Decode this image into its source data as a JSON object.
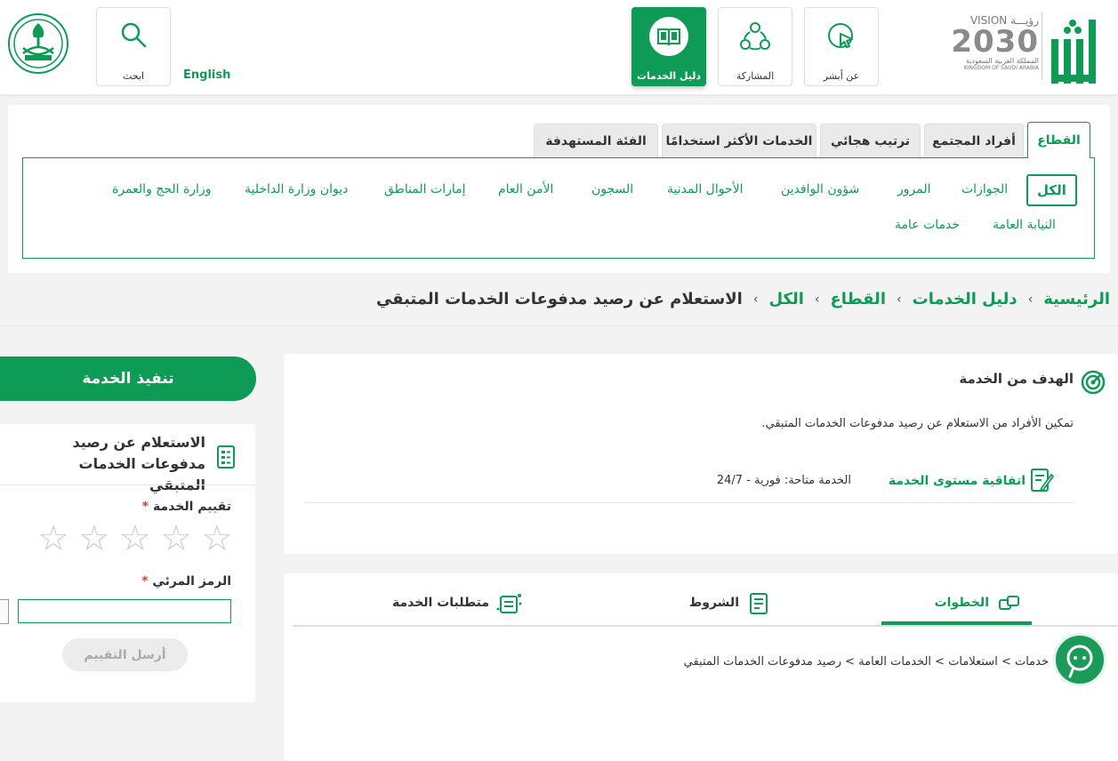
{
  "header": {
    "nav": [
      {
        "label": "عن أبشر",
        "icon": "cursor-click-icon"
      },
      {
        "label": "المشاركة",
        "icon": "people-network-icon"
      },
      {
        "label": "دليل الخدمات",
        "icon": "book-icon",
        "active": true
      }
    ],
    "language_label": "English",
    "search_label": "ابحث",
    "vision": {
      "title": "VISION رؤيـــة",
      "year": "2030",
      "line_ar": "المملكة العربية السعودية",
      "line_en": "KINGDOM OF SAUDI ARABIA"
    },
    "logo_text": "أبشر"
  },
  "filter": {
    "tabs": [
      "القطاع",
      "أفراد المجتمع",
      "ترتيب هجائي",
      "الخدمات الأكثر استخدامًا",
      "الفئة المستهدفة"
    ],
    "sectors_row1": [
      "الكل",
      "الجوازات",
      "المرور",
      "شؤون الوافدين",
      "الأحوال المدنية",
      "السجون",
      "الأمن العام",
      "إمارات المناطق",
      "ديوان وزارة الداخلية",
      "وزارة الحج والعمرة"
    ],
    "sectors_row2": [
      "النيابة العامة",
      "خدمات عامة"
    ]
  },
  "breadcrumb": {
    "items": [
      "الرئيسية",
      "دليل الخدمات",
      "القطاع",
      "الكل"
    ],
    "separator": "›",
    "current": "الاستعلام عن رصيد مدفوعات الخدمات المتبقي"
  },
  "goal": {
    "title": "الهدف من الخدمة",
    "text": "تمكين الأفراد من الاستعلام عن رصيد مدفوعات الخدمات المتبقي.",
    "sla_label": "اتفاقية مستوى الخدمة",
    "availability": "الخدمة متاحة: فورية - 24/7"
  },
  "tabs2": {
    "items": [
      "الخطوات",
      "الشروط",
      "متطلبات الخدمة"
    ],
    "steps_text": "خدمات > استعلامات > الخدمات العامة > رصيد مدفوعات الخدمات المتبقي"
  },
  "side": {
    "execute_label": "تنفيذ الخدمة",
    "service_title": "الاستعلام عن رصيد مدفوعات الخدمات المتبقي",
    "rating_label": "تقييم الخدمة",
    "required_mark": "*",
    "stars_total": 5,
    "stars_selected": 0,
    "captcha_label": "الرمز المرئي",
    "captcha_value": "",
    "submit_label": "أرسل التقييم"
  },
  "colors": {
    "accent": "#0e9b56",
    "accent_dark": "#0a7a44",
    "required": "#e53935"
  }
}
